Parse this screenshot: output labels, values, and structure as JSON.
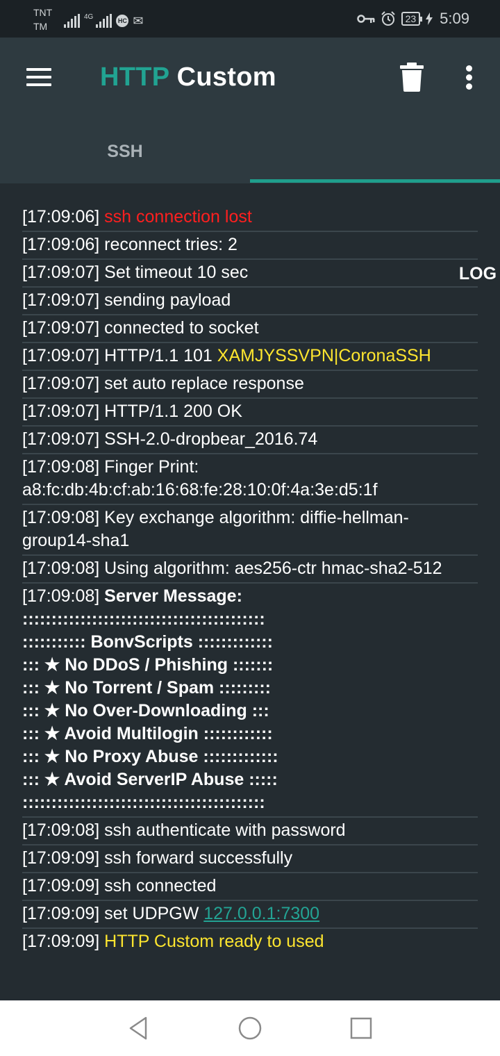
{
  "status_bar": {
    "carrier_line1": "TNT",
    "carrier_line2": "TM",
    "network_type": "4G",
    "badge": "HC",
    "battery_level": "23",
    "time": "5:09"
  },
  "app_bar": {
    "title_part1": "HTTP",
    "title_part2": "Custom",
    "icons": [
      "menu-icon",
      "trash-icon",
      "more-vert-icon"
    ]
  },
  "tabs": [
    {
      "label": "SSH",
      "active": false
    },
    {
      "label": "LOG",
      "active": true
    }
  ],
  "colors": {
    "accent": "#1f9e8c",
    "error": "#ff1f1f",
    "highlight": "#fde52f",
    "background": "#242c31",
    "appbar": "#2e3a40"
  },
  "log": [
    {
      "time": "[17:09:06]",
      "text": "ssh connection lost",
      "style": "red"
    },
    {
      "time": "[17:09:06]",
      "text": "reconnect tries: 2"
    },
    {
      "time": "[17:09:07]",
      "text": "Set timeout 10 sec"
    },
    {
      "time": "[17:09:07]",
      "text": "sending payload"
    },
    {
      "time": "[17:09:07]",
      "text": "connected to socket"
    },
    {
      "time": "[17:09:07]",
      "text": "HTTP/1.1 101",
      "extra": "XAMJYSSVPN|CoronaSSH"
    },
    {
      "time": "[17:09:07]",
      "text": "set auto replace response"
    },
    {
      "time": "[17:09:07]",
      "text": "HTTP/1.1 200 OK"
    },
    {
      "time": "[17:09:07]",
      "text": "SSH-2.0-dropbear_2016.74"
    },
    {
      "time": "[17:09:08]",
      "text": "Finger Print: a8:fc:db:4b:cf:ab:16:68:fe:28:10:0f:4a:3e:d5:1f"
    },
    {
      "time": "[17:09:08]",
      "text": "Key exchange algorithm: diffie-hellman-group14-sha1"
    },
    {
      "time": "[17:09:08]",
      "text": "Using algorithm: aes256-ctr hmac-sha2-512"
    },
    {
      "time": "[17:09:08]",
      "text": "Server Message:",
      "message": [
        "::::::::::::::::::::::::::::::::::::::::::",
        "::::::::::: BonvScripts :::::::::::::",
        "::: ★ No DDoS / Phishing :::::::",
        "::: ★ No Torrent / Spam :::::::::",
        "::: ★ No Over-Downloading :::",
        "::: ★ Avoid Multilogin ::::::::::::",
        "::: ★ No Proxy Abuse :::::::::::::",
        "::: ★ Avoid ServerIP Abuse :::::",
        "::::::::::::::::::::::::::::::::::::::::::"
      ]
    },
    {
      "time": "[17:09:08]",
      "text": "ssh authenticate with password"
    },
    {
      "time": "[17:09:09]",
      "text": "ssh forward successfully"
    },
    {
      "time": "[17:09:09]",
      "text": "ssh connected"
    },
    {
      "time": "[17:09:09]",
      "text": "set UDPGW",
      "link": "127.0.0.1:7300"
    },
    {
      "time": "[17:09:09]",
      "text": "HTTP Custom ready to used",
      "style": "yellow"
    }
  ],
  "nav_bar": {
    "icons": [
      "back-icon",
      "home-icon",
      "recents-icon"
    ]
  }
}
